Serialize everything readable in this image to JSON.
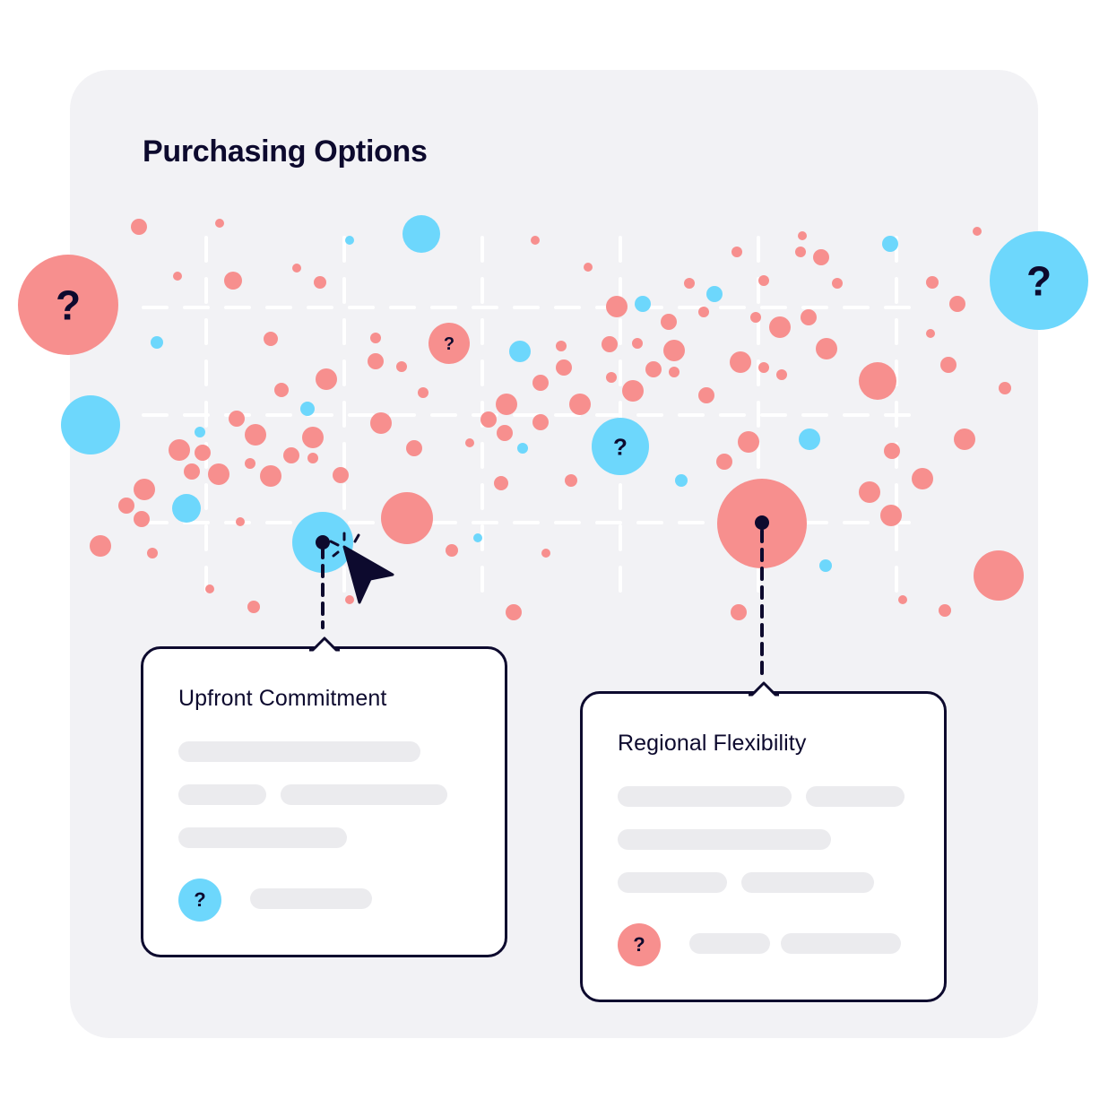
{
  "title": "Purchasing Options",
  "colors": {
    "background": "#ffffff",
    "panel": "#f2f2f5",
    "ink": "#0d0a2e",
    "salmon": "#f78f8e",
    "sky": "#6dd7fc",
    "grid": "#ffffff",
    "skeleton": "#ebebee"
  },
  "question_glyph": "?",
  "highlight_bubbles": [
    {
      "name": "large-salmon-question-bubble",
      "color": "salmon",
      "glyph": "?"
    },
    {
      "name": "large-sky-question-bubble",
      "color": "sky",
      "glyph": "?"
    },
    {
      "name": "salmon-question-bubble",
      "color": "salmon",
      "glyph": "?"
    },
    {
      "name": "sky-question-bubble",
      "color": "sky",
      "glyph": "?"
    }
  ],
  "cards": [
    {
      "title": "Upfront Commitment",
      "linked_bubble_color": "sky",
      "footer_icon": "question-icon",
      "footer_icon_color": "sky",
      "footer_glyph": "?"
    },
    {
      "title": "Regional Flexibility",
      "linked_bubble_color": "salmon",
      "footer_icon": "question-icon",
      "footer_icon_color": "salmon",
      "footer_glyph": "?"
    }
  ],
  "cursor": {
    "icon": "mouse-pointer-icon",
    "state": "clicking"
  }
}
